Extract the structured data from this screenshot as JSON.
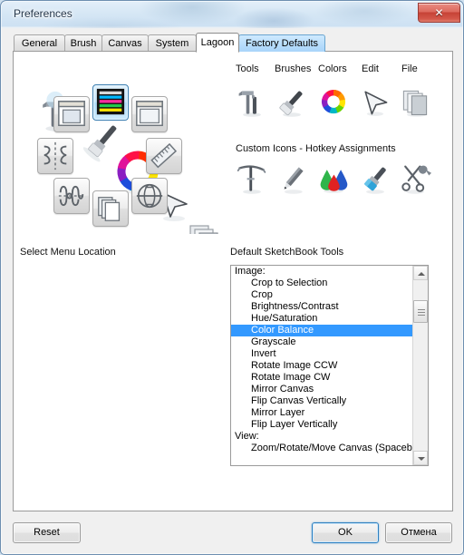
{
  "window": {
    "title": "Preferences",
    "close_label": "✕"
  },
  "tabs": [
    {
      "label": "General",
      "state": "normal"
    },
    {
      "label": "Brush",
      "state": "normal"
    },
    {
      "label": "Canvas",
      "state": "normal"
    },
    {
      "label": "System",
      "state": "normal"
    },
    {
      "label": "Lagoon",
      "state": "active"
    },
    {
      "label": "Factory Defaults",
      "state": "hover"
    }
  ],
  "lagoon_preview": {
    "icons": [
      "tools-hammer-icon",
      "brush-icon",
      "color-wheel-icon",
      "cursor-arrow-icon",
      "layers-icon"
    ],
    "puck_icon": "lagoon-puck-icon"
  },
  "columns": {
    "headers": [
      "Tools",
      "Brushes",
      "Colors",
      "Edit",
      "File"
    ],
    "icons": [
      "tools-hammer-icon",
      "brush-icon",
      "color-wheel-icon",
      "cursor-arrow-icon",
      "layers-icon"
    ]
  },
  "custom_icons": {
    "label": "Custom Icons - Hotkey Assignments",
    "icons": [
      "pickaxe-icon",
      "pencil-icon",
      "paint-drops-icon",
      "airbrush-icon",
      "scissors-wrench-icon"
    ]
  },
  "menu_location": {
    "label": "Select Menu Location",
    "buttons": [
      {
        "name": "menu-location-top-left",
        "icon": "window-panel-left-icon",
        "selected": false
      },
      {
        "name": "menu-location-top-center",
        "icon": "color-bars-icon",
        "selected": true
      },
      {
        "name": "menu-location-top-right",
        "icon": "window-panel-right-icon",
        "selected": false
      },
      {
        "name": "menu-location-left",
        "icon": "mirror-vertical-icon",
        "selected": false
      },
      {
        "name": "menu-location-right",
        "icon": "ruler-icon",
        "selected": false
      },
      {
        "name": "menu-location-bottom-left",
        "icon": "mirror-horizontal-icon",
        "selected": false
      },
      {
        "name": "menu-location-bottom-center",
        "icon": "layers-stack-icon",
        "selected": false
      },
      {
        "name": "menu-location-bottom-right",
        "icon": "globe-flip-icon",
        "selected": false
      }
    ]
  },
  "default_tools": {
    "label": "Default SketchBook Tools",
    "items": [
      {
        "text": "Image:",
        "indent": false,
        "selected": false
      },
      {
        "text": "Crop to Selection",
        "indent": true,
        "selected": false
      },
      {
        "text": "Crop",
        "indent": true,
        "selected": false
      },
      {
        "text": "Brightness/Contrast",
        "indent": true,
        "selected": false
      },
      {
        "text": "Hue/Saturation",
        "indent": true,
        "selected": false
      },
      {
        "text": "Color Balance",
        "indent": true,
        "selected": true
      },
      {
        "text": "Grayscale",
        "indent": true,
        "selected": false
      },
      {
        "text": "Invert",
        "indent": true,
        "selected": false
      },
      {
        "text": "Rotate Image CCW",
        "indent": true,
        "selected": false
      },
      {
        "text": "Rotate Image CW",
        "indent": true,
        "selected": false
      },
      {
        "text": "Mirror Canvas",
        "indent": true,
        "selected": false
      },
      {
        "text": "Flip Canvas Vertically",
        "indent": true,
        "selected": false
      },
      {
        "text": "Mirror Layer",
        "indent": true,
        "selected": false
      },
      {
        "text": "Flip Layer Vertically",
        "indent": true,
        "selected": false
      },
      {
        "text": "View:",
        "indent": false,
        "selected": false
      },
      {
        "text": "Zoom/Rotate/Move Canvas (Spaceba",
        "indent": true,
        "selected": false
      }
    ]
  },
  "footer": {
    "reset_label": "Reset",
    "ok_label": "OK",
    "cancel_label": "Отмена"
  },
  "colors": {
    "selection_blue": "#3399ff",
    "tab_hover_blue": "#b6dcfb",
    "default_button_border": "#2c7fc0",
    "close_button_red": "#c64236"
  }
}
